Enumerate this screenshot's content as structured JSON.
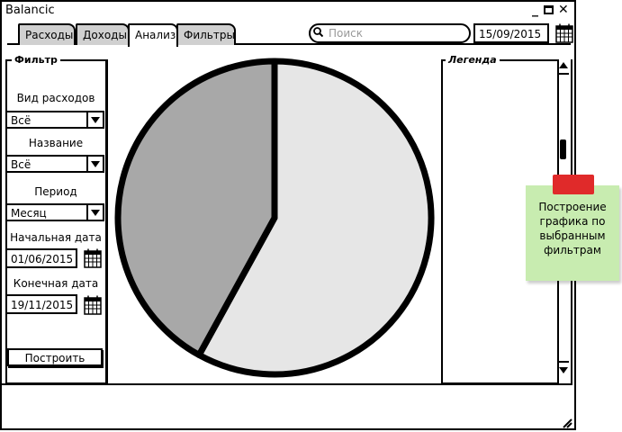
{
  "window": {
    "title": "Balancic"
  },
  "tabs": [
    {
      "label": "Расходы"
    },
    {
      "label": "Доходы"
    },
    {
      "label": "Анализ"
    },
    {
      "label": "Фильтры"
    }
  ],
  "search": {
    "placeholder": "Поиск"
  },
  "header_date": "15/09/2015",
  "filter": {
    "title": "Фильтр",
    "expense_type_label": "Вид расходов",
    "expense_type_value": "Всё",
    "name_label": "Название",
    "name_value": "Всё",
    "period_label": "Период",
    "period_value": "Месяц",
    "start_label": "Начальная дата",
    "start_value": "01/06/2015",
    "end_label": "Конечная дата",
    "end_value": "19/11/2015",
    "build_button": "Построить"
  },
  "legend": {
    "title": "Легенда"
  },
  "chart_data": {
    "type": "pie",
    "values": [
      58,
      42
    ],
    "colors": [
      "#e6e6e6",
      "#a8a8a8"
    ]
  },
  "note": {
    "text": "Построение графика по выбранным фильтрам",
    "color": "#c8ecb0",
    "tape_color": "#e02a2a"
  }
}
